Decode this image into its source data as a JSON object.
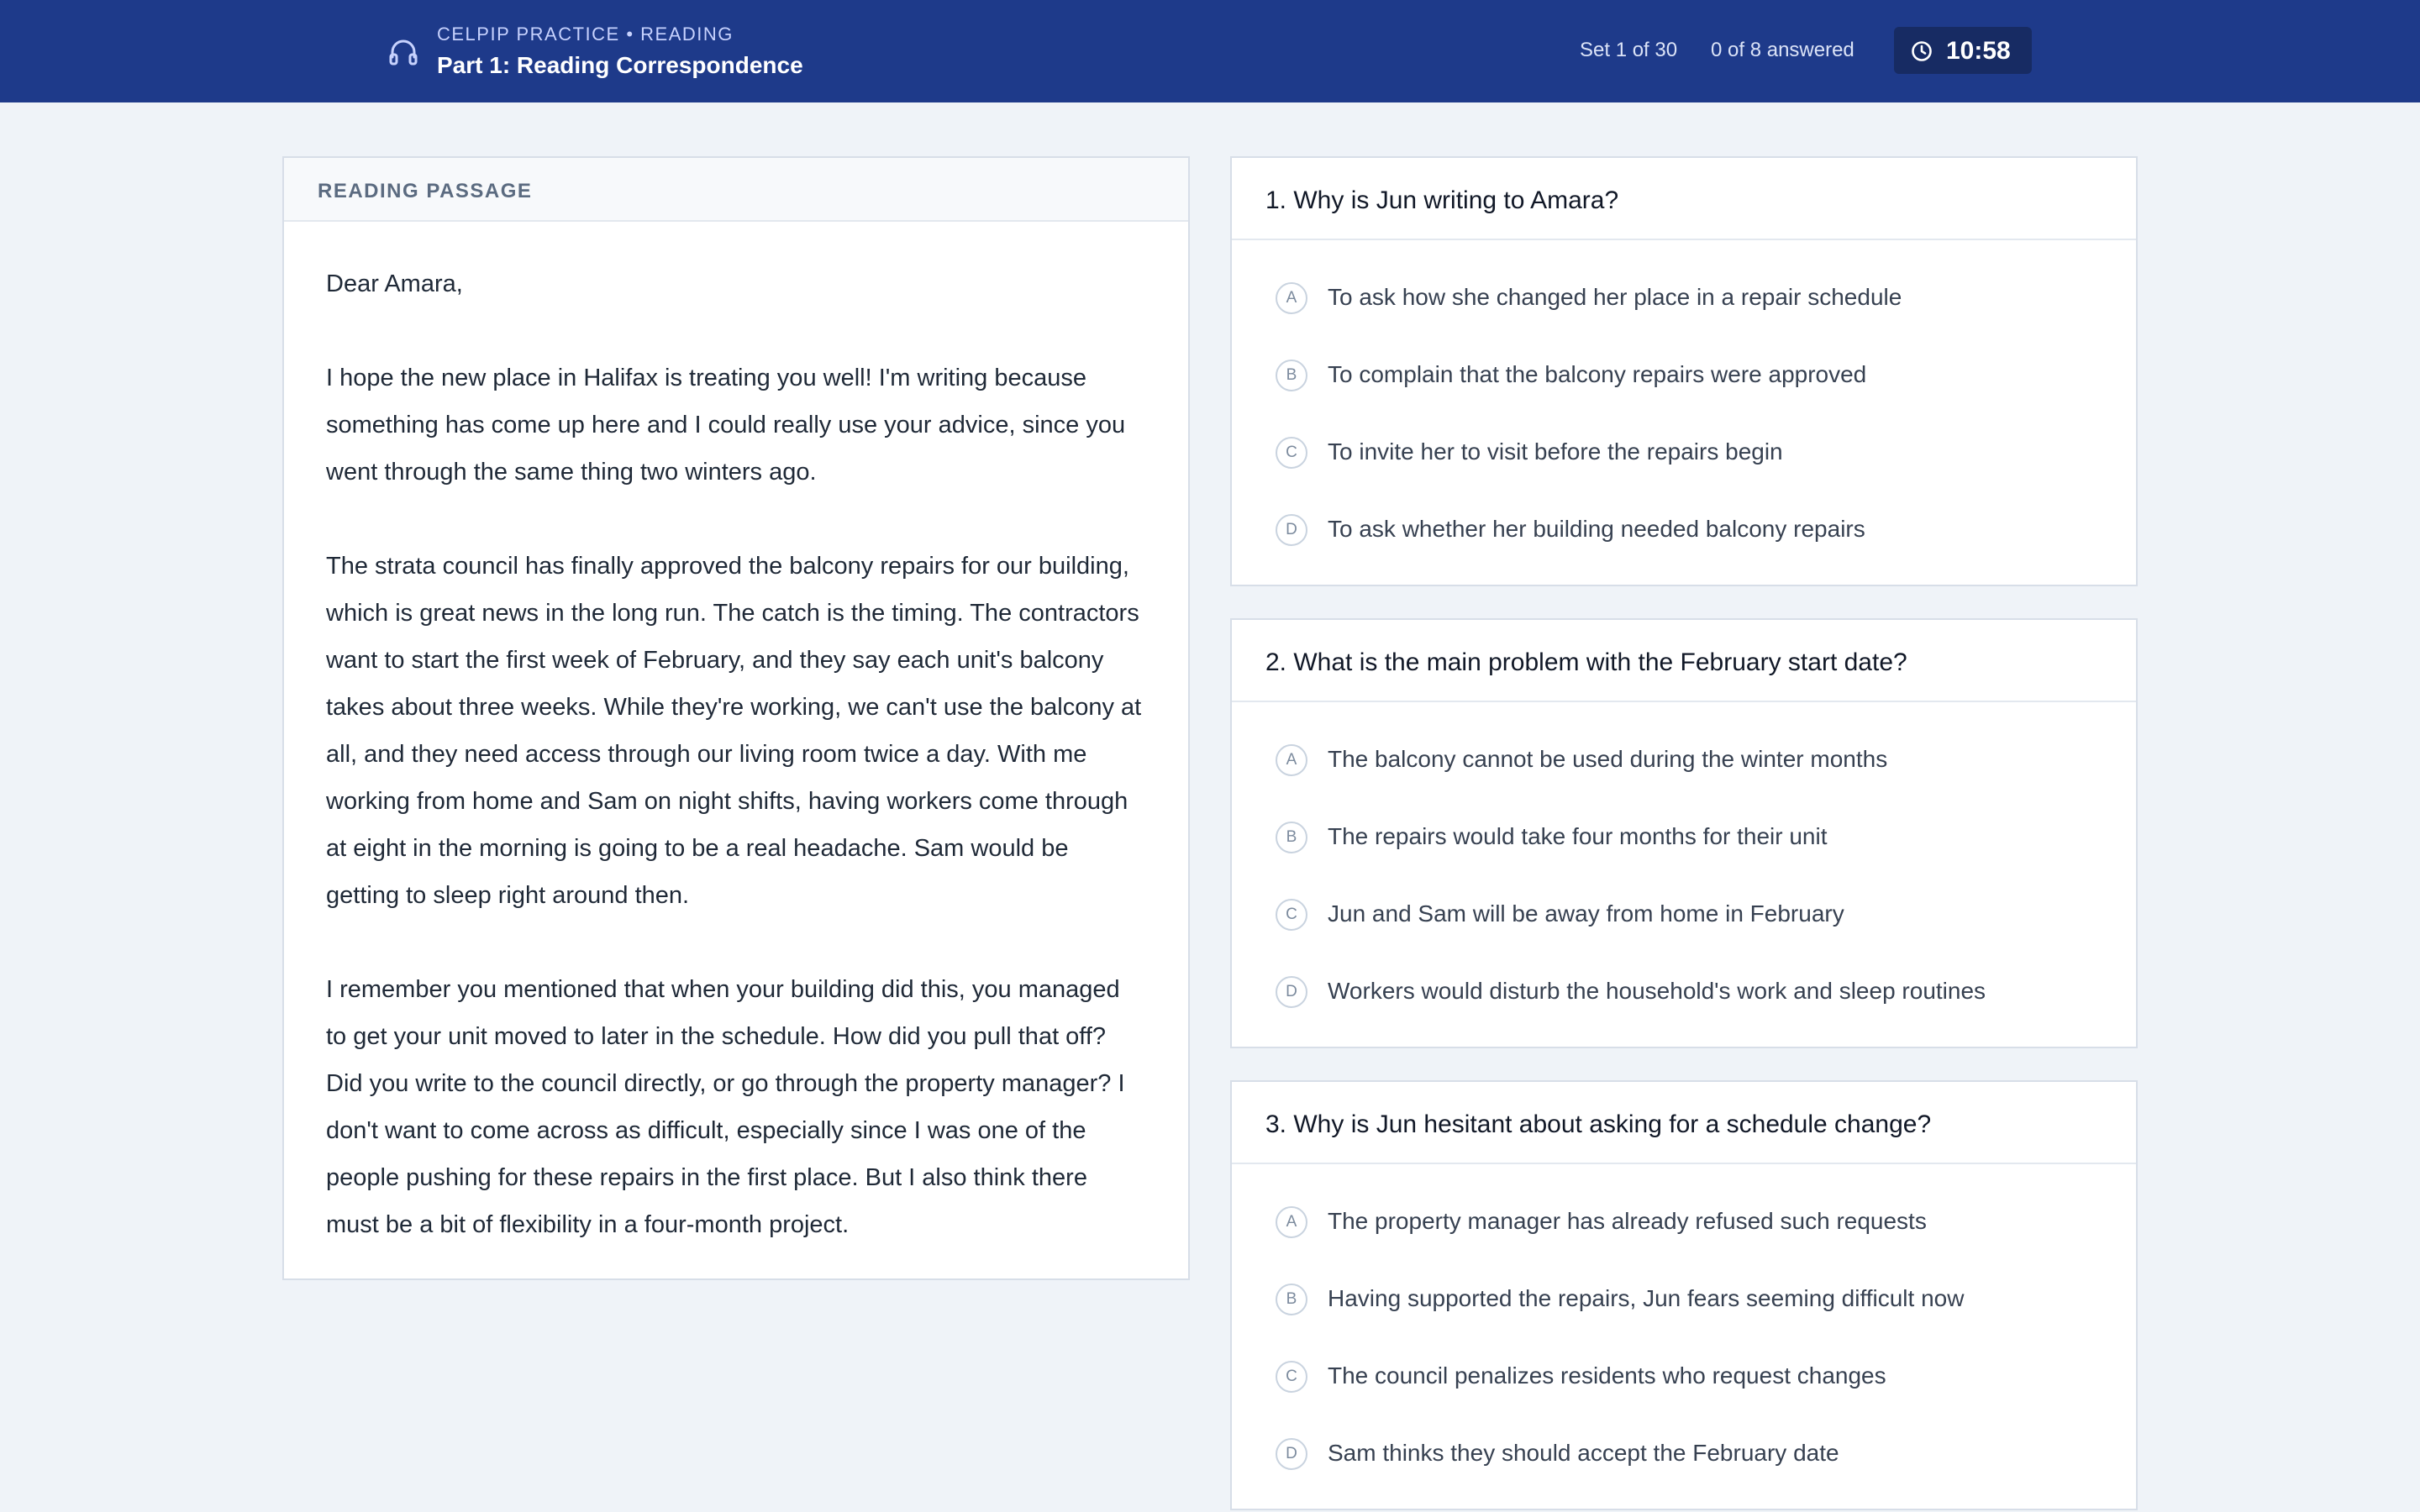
{
  "header": {
    "subtitle": "CELPIP PRACTICE • READING",
    "title": "Part 1: Reading Correspondence",
    "set_info": "Set 1 of 30",
    "answered_info": "0 of 8 answered",
    "timer": "10:58",
    "icons": {
      "brand": "headphones-icon",
      "timer": "clock-icon"
    }
  },
  "passage": {
    "label": "READING PASSAGE",
    "paragraphs": [
      "Dear Amara,",
      "I hope the new place in Halifax is treating you well! I'm writing because something has come up here and I could really use your advice, since you went through the same thing two winters ago.",
      "The strata council has finally approved the balcony repairs for our building, which is great news in the long run. The catch is the timing. The contractors want to start the first week of February, and they say each unit's balcony takes about three weeks. While they're working, we can't use the balcony at all, and they need access through our living room twice a day. With me working from home and Sam on night shifts, having workers come through at eight in the morning is going to be a real headache. Sam would be getting to sleep right around then.",
      "I remember you mentioned that when your building did this, you managed to get your unit moved to later in the schedule. How did you pull that off? Did you write to the council directly, or go through the property manager? I don't want to come across as difficult, especially since I was one of the people pushing for these repairs in the first place. But I also think there must be a bit of flexibility in a four-month project."
    ]
  },
  "questions": [
    {
      "title": "1. Why is Jun writing to Amara?",
      "options": [
        {
          "letter": "A",
          "text": "To ask how she changed her place in a repair schedule"
        },
        {
          "letter": "B",
          "text": "To complain that the balcony repairs were approved"
        },
        {
          "letter": "C",
          "text": "To invite her to visit before the repairs begin"
        },
        {
          "letter": "D",
          "text": "To ask whether her building needed balcony repairs"
        }
      ]
    },
    {
      "title": "2. What is the main problem with the February start date?",
      "options": [
        {
          "letter": "A",
          "text": "The balcony cannot be used during the winter months"
        },
        {
          "letter": "B",
          "text": "The repairs would take four months for their unit"
        },
        {
          "letter": "C",
          "text": "Jun and Sam will be away from home in February"
        },
        {
          "letter": "D",
          "text": "Workers would disturb the household's work and sleep routines"
        }
      ]
    },
    {
      "title": "3. Why is Jun hesitant about asking for a schedule change?",
      "options": [
        {
          "letter": "A",
          "text": "The property manager has already refused such requests"
        },
        {
          "letter": "B",
          "text": "Having supported the repairs, Jun fears seeming difficult now"
        },
        {
          "letter": "C",
          "text": "The council penalizes residents who request changes"
        },
        {
          "letter": "D",
          "text": "Sam thinks they should accept the February date"
        }
      ]
    }
  ]
}
